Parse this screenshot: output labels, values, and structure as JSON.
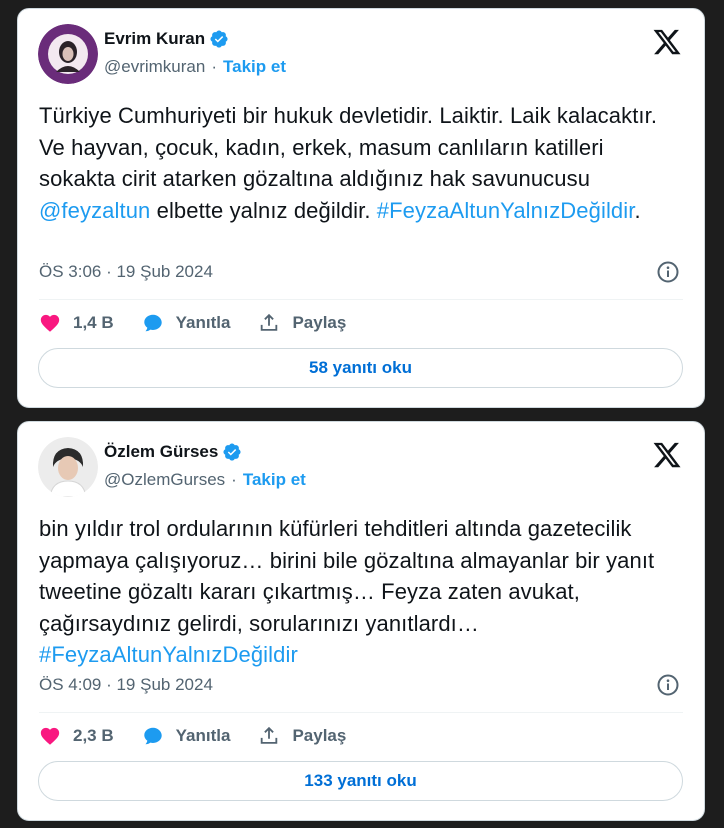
{
  "tweets": [
    {
      "author": {
        "name": "Evrim Kuran",
        "handle": "@evrimkuran",
        "follow_label": "Takip et"
      },
      "text": {
        "part1": "Türkiye Cumhuriyeti bir hukuk devletidir. Laiktir. Laik kalacaktır. Ve hayvan, çocuk, kadın, erkek, masum canlıların katilleri sokakta cirit atarken gözaltına aldığınız hak savunucusu ",
        "mention": "@feyzaltun",
        "part2": " elbette yalnız değildir. ",
        "hashtag": "#FeyzaAltunYalnızDeğildir",
        "part3": "."
      },
      "timestamp": "ÖS 3:06 · 19 Şub 2024",
      "likes": "1,4 B",
      "reply_label": "Yanıtla",
      "share_label": "Paylaş",
      "read_replies": "58 yanıtı oku"
    },
    {
      "author": {
        "name": "Özlem Gürses",
        "handle": "@OzlemGurses",
        "follow_label": "Takip et"
      },
      "text": {
        "part1": "bin yıldır trol ordularının küfürleri tehditleri altında gazetecilik yapmaya çalışıyoruz… birini bile gözaltına almayanlar bir yanıt tweetine gözaltı kararı çıkartmış… Feyza zaten avukat, çağırsaydınız gelirdi, sorularınızı yanıtlardı… ",
        "hashtag": "#FeyzaAltunYalnızDeğildir"
      },
      "timestamp": "ÖS 4:09 · 19 Şub 2024",
      "likes": "2,3 B",
      "reply_label": "Yanıtla",
      "share_label": "Paylaş",
      "read_replies": "133 yanıtı oku"
    }
  ],
  "colors": {
    "accent": "#1d9bf0",
    "heart": "#f91880",
    "background": "#1d1d1d"
  },
  "icons": [
    "verified-badge-icon",
    "x-logo-icon",
    "info-icon",
    "heart-icon",
    "reply-bubble-icon",
    "share-icon"
  ]
}
